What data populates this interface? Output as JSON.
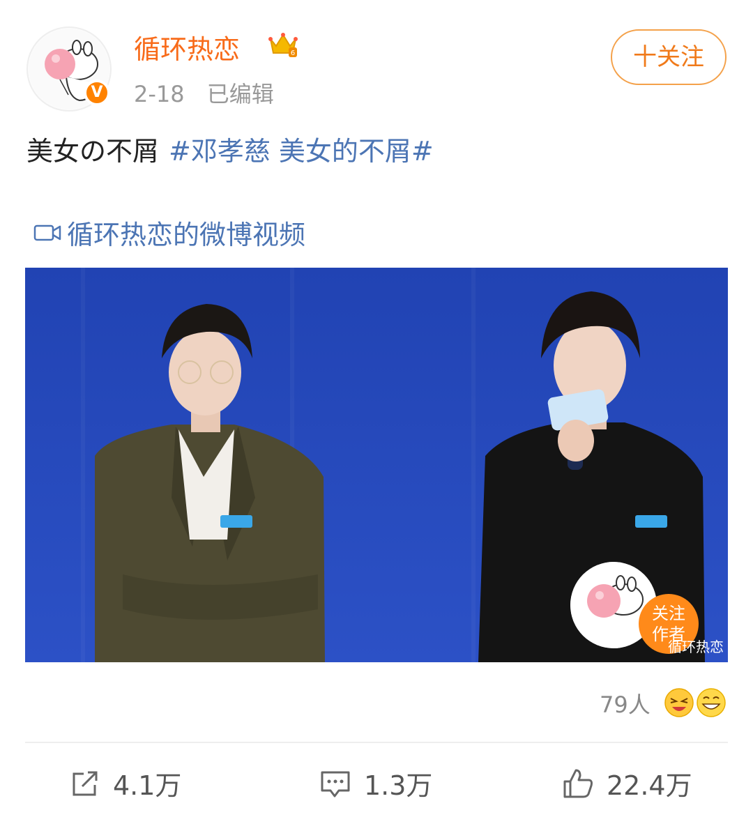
{
  "header": {
    "username": "循环热恋",
    "verified_badge": "V",
    "date": "2-18",
    "edited": "已编辑",
    "follow_label": "十关注"
  },
  "post": {
    "text": "美女の不屑",
    "hashtag": "#邓孝慈 美女的不屑#",
    "video_link": "循环热恋的微博视频"
  },
  "video": {
    "follow_author": [
      "关注",
      "作者"
    ],
    "watermark": "循环热恋"
  },
  "viewers": {
    "count": "79人"
  },
  "actions": {
    "repost": "4.1万",
    "comment": "1.3万",
    "like": "22.4万"
  },
  "colors": {
    "username": "#f86b1a",
    "link": "#4c75b4",
    "accent": "#ff8200"
  },
  "icons": [
    "crown-icon",
    "video-camera-icon",
    "repost-icon",
    "comment-icon",
    "like-icon"
  ]
}
